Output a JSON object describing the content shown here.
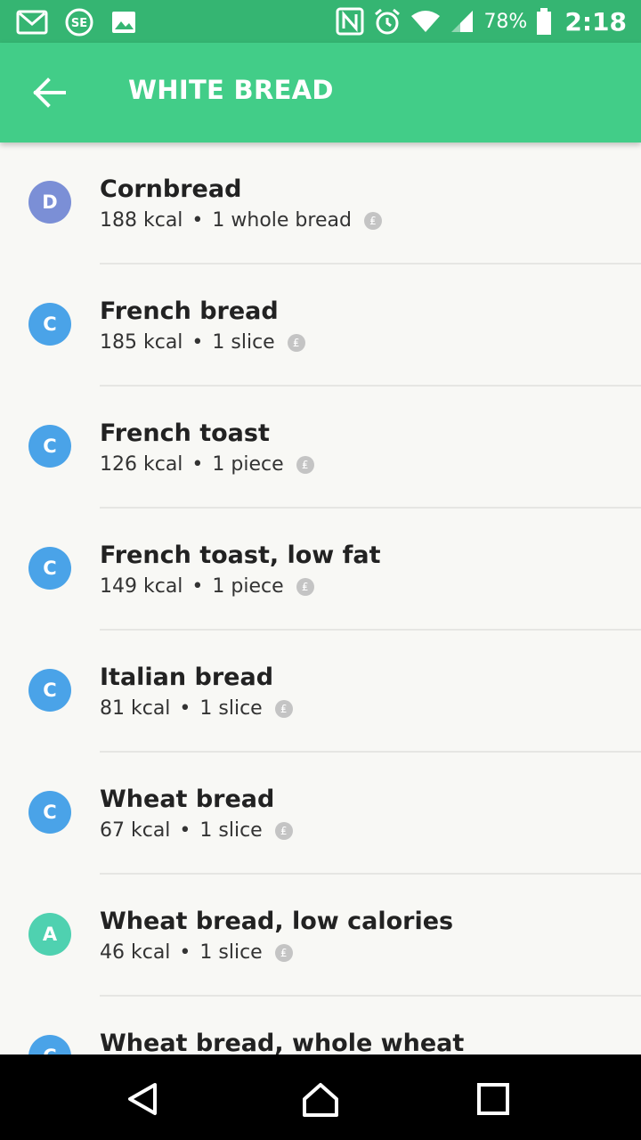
{
  "status_bar": {
    "left_icons": [
      "gmail-icon",
      "sf-app-icon",
      "gallery-icon"
    ],
    "right_icons": [
      "nfc-icon",
      "alarm-icon",
      "wifi-icon",
      "signal-icon",
      "battery-icon"
    ],
    "battery": "78%",
    "time": "2:18"
  },
  "app_bar": {
    "title": "WHITE BREAD",
    "back_icon": "arrow-back-icon"
  },
  "colors": {
    "status_bar": "#35b572",
    "app_bar": "#42cd88",
    "grade_A": "#4fd1b0",
    "grade_C": "#4aa3e8",
    "grade_D": "#7b8fd6"
  },
  "items": [
    {
      "grade": "D",
      "name": "Cornbread",
      "kcal": "188 kcal",
      "serving": "1 whole bread"
    },
    {
      "grade": "C",
      "name": "French bread",
      "kcal": "185 kcal",
      "serving": "1 slice"
    },
    {
      "grade": "C",
      "name": "French toast",
      "kcal": "126 kcal",
      "serving": "1 piece"
    },
    {
      "grade": "C",
      "name": "French toast, low fat",
      "kcal": "149 kcal",
      "serving": "1 piece"
    },
    {
      "grade": "C",
      "name": "Italian bread",
      "kcal": "81 kcal",
      "serving": "1 slice"
    },
    {
      "grade": "C",
      "name": "Wheat bread",
      "kcal": "67 kcal",
      "serving": "1 slice"
    },
    {
      "grade": "A",
      "name": "Wheat bread, low calories",
      "kcal": "46 kcal",
      "serving": "1 slice"
    },
    {
      "grade": "C",
      "name": "Wheat bread, whole wheat",
      "kcal": "",
      "serving": ""
    }
  ],
  "nav_bar": {
    "buttons": [
      "back-nav-icon",
      "home-nav-icon",
      "recents-nav-icon"
    ]
  }
}
